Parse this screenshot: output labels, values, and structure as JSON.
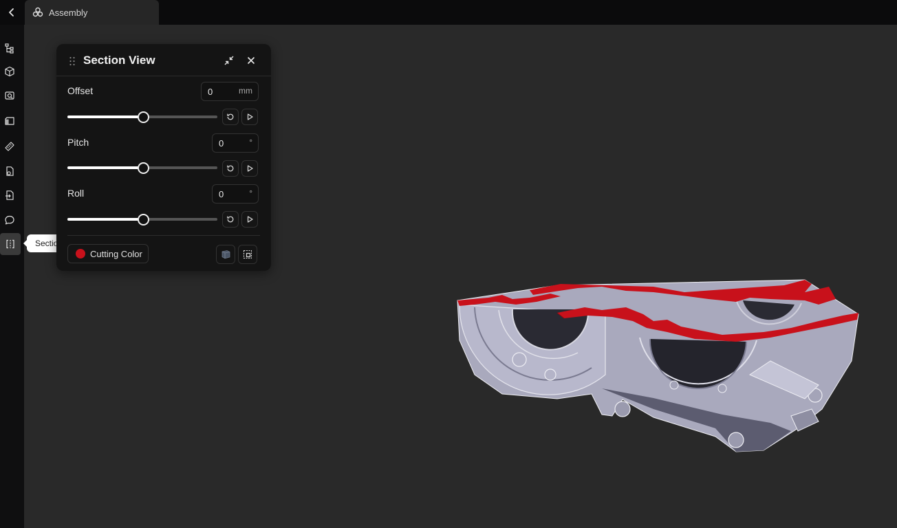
{
  "topbar": {
    "tab_label": "Assembly",
    "tab_icon": "assembly-icon",
    "back_icon": "chevron-left-icon"
  },
  "sidebar": {
    "items": [
      {
        "icon": "tree-icon"
      },
      {
        "icon": "cube-icon"
      },
      {
        "icon": "views-icon"
      },
      {
        "icon": "shading-icon"
      },
      {
        "icon": "measure-icon"
      },
      {
        "icon": "properties-icon"
      },
      {
        "icon": "export-icon"
      },
      {
        "icon": "comment-icon"
      },
      {
        "icon": "section-view-icon",
        "active": true
      }
    ],
    "tooltip": "Section View"
  },
  "panel": {
    "title": "Section View",
    "offset": {
      "label": "Offset",
      "value": "0",
      "unit": "mm",
      "slider_position": 0.5
    },
    "pitch": {
      "label": "Pitch",
      "value": "0",
      "unit": "°",
      "slider_position": 0.5
    },
    "roll": {
      "label": "Roll",
      "value": "0",
      "unit": "°",
      "slider_position": 0.5
    },
    "cutting_color": {
      "label": "Cutting Color",
      "color": "#c8111b"
    }
  },
  "colors": {
    "background": "#292929",
    "panel": "#141414",
    "cut_face": "#c8111b",
    "model": "#a9a9bd"
  }
}
